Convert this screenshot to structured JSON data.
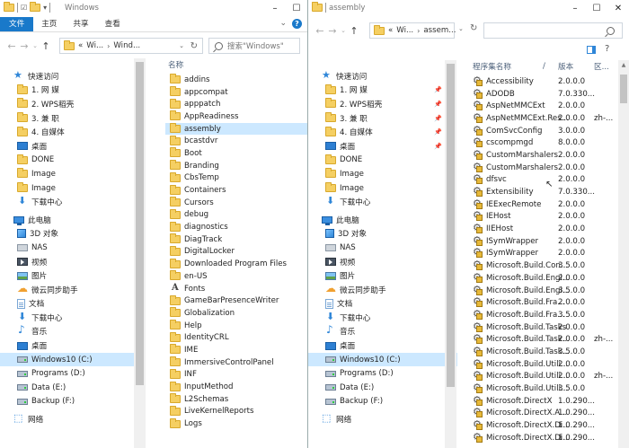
{
  "left": {
    "title": "Windows",
    "tabs": [
      "文件",
      "主页",
      "共享",
      "查看"
    ],
    "address": [
      "Wi...",
      "Wind..."
    ],
    "address_prefix": "«",
    "search_placeholder": "搜索\"Windows\"",
    "column_name": "名称",
    "nav": [
      {
        "label": "快速访问",
        "icon": "star-icon",
        "pinned": false
      },
      {
        "label": "1. 网    媒",
        "icon": "folder-icon",
        "pinned": true
      },
      {
        "label": "2. WPS稻壳",
        "icon": "folder-icon",
        "pinned": true
      },
      {
        "label": "3. 兼    职",
        "icon": "folder-icon",
        "pinned": true
      },
      {
        "label": "4. 自媒体",
        "icon": "folder-icon",
        "pinned": true
      },
      {
        "label": "桌面",
        "icon": "desktop-icon",
        "pinned": true
      },
      {
        "label": "DONE",
        "icon": "folder-icon",
        "pinned": false
      },
      {
        "label": "Image",
        "icon": "folder-icon",
        "pinned": false
      },
      {
        "label": "Image",
        "icon": "folder-icon",
        "pinned": false
      },
      {
        "label": "下载中心",
        "icon": "download-icon",
        "pinned": false
      },
      {
        "label": "此电脑",
        "icon": "pc-icon",
        "pinned": false,
        "gap": true
      },
      {
        "label": "3D 对象",
        "icon": "cube-icon",
        "pinned": false
      },
      {
        "label": "NAS",
        "icon": "nas-icon",
        "pinned": false
      },
      {
        "label": "视频",
        "icon": "video-icon",
        "pinned": false
      },
      {
        "label": "图片",
        "icon": "picture-icon",
        "pinned": false
      },
      {
        "label": "微云同步助手",
        "icon": "cloud-icon",
        "pinned": false
      },
      {
        "label": "文档",
        "icon": "document-icon",
        "pinned": false
      },
      {
        "label": "下载中心",
        "icon": "download-icon",
        "pinned": false
      },
      {
        "label": "音乐",
        "icon": "music-icon",
        "pinned": false
      },
      {
        "label": "桌面",
        "icon": "desktop-icon",
        "pinned": false
      },
      {
        "label": "Windows10 (C:)",
        "icon": "drive-icon",
        "pinned": false,
        "selected": true
      },
      {
        "label": "Programs (D:)",
        "icon": "drive-icon",
        "pinned": false
      },
      {
        "label": "Data (E:)",
        "icon": "drive-icon",
        "pinned": false
      },
      {
        "label": "Backup (F:)",
        "icon": "drive-icon",
        "pinned": false
      },
      {
        "label": "网络",
        "icon": "network-icon",
        "pinned": false,
        "gap": true
      }
    ],
    "files": [
      {
        "name": "addins",
        "icon": "folder-icon"
      },
      {
        "name": "appcompat",
        "icon": "folder-icon"
      },
      {
        "name": "apppatch",
        "icon": "folder-icon"
      },
      {
        "name": "AppReadiness",
        "icon": "folder-icon"
      },
      {
        "name": "assembly",
        "icon": "folder-icon",
        "selected": true
      },
      {
        "name": "bcastdvr",
        "icon": "folder-icon"
      },
      {
        "name": "Boot",
        "icon": "folder-icon"
      },
      {
        "name": "Branding",
        "icon": "folder-icon"
      },
      {
        "name": "CbsTemp",
        "icon": "folder-icon"
      },
      {
        "name": "Containers",
        "icon": "folder-icon"
      },
      {
        "name": "Cursors",
        "icon": "folder-icon"
      },
      {
        "name": "debug",
        "icon": "folder-icon"
      },
      {
        "name": "diagnostics",
        "icon": "folder-icon"
      },
      {
        "name": "DiagTrack",
        "icon": "folder-icon"
      },
      {
        "name": "DigitalLocker",
        "icon": "folder-icon"
      },
      {
        "name": "Downloaded Program Files",
        "icon": "folder-icon"
      },
      {
        "name": "en-US",
        "icon": "folder-icon"
      },
      {
        "name": "Fonts",
        "icon": "font-folder-icon"
      },
      {
        "name": "GameBarPresenceWriter",
        "icon": "folder-icon"
      },
      {
        "name": "Globalization",
        "icon": "folder-icon"
      },
      {
        "name": "Help",
        "icon": "folder-icon"
      },
      {
        "name": "IdentityCRL",
        "icon": "folder-icon"
      },
      {
        "name": "IME",
        "icon": "folder-icon"
      },
      {
        "name": "ImmersiveControlPanel",
        "icon": "folder-icon"
      },
      {
        "name": "INF",
        "icon": "folder-icon"
      },
      {
        "name": "InputMethod",
        "icon": "folder-icon"
      },
      {
        "name": "L2Schemas",
        "icon": "folder-icon"
      },
      {
        "name": "LiveKernelReports",
        "icon": "folder-icon"
      },
      {
        "name": "Logs",
        "icon": "folder-icon"
      }
    ]
  },
  "right": {
    "title": "assembly",
    "address": [
      "Wi...",
      "assem..."
    ],
    "address_prefix": "«",
    "columns": [
      "程序集名称",
      "/",
      "版本",
      "区..."
    ],
    "nav": [
      {
        "label": "快速访问",
        "icon": "star-icon",
        "pinned": false
      },
      {
        "label": "1. 网    媒",
        "icon": "folder-icon",
        "pinned": true
      },
      {
        "label": "2. WPS稻壳",
        "icon": "folder-icon",
        "pinned": true
      },
      {
        "label": "3. 兼    职",
        "icon": "folder-icon",
        "pinned": true
      },
      {
        "label": "4. 自媒体",
        "icon": "folder-icon",
        "pinned": true
      },
      {
        "label": "桌面",
        "icon": "desktop-icon",
        "pinned": true
      },
      {
        "label": "DONE",
        "icon": "folder-icon",
        "pinned": false
      },
      {
        "label": "Image",
        "icon": "folder-icon",
        "pinned": false
      },
      {
        "label": "Image",
        "icon": "folder-icon",
        "pinned": false
      },
      {
        "label": "下载中心",
        "icon": "download-icon",
        "pinned": false
      },
      {
        "label": "此电脑",
        "icon": "pc-icon",
        "pinned": false,
        "gap": true
      },
      {
        "label": "3D 对象",
        "icon": "cube-icon",
        "pinned": false
      },
      {
        "label": "NAS",
        "icon": "nas-icon",
        "pinned": false
      },
      {
        "label": "视频",
        "icon": "video-icon",
        "pinned": false
      },
      {
        "label": "图片",
        "icon": "picture-icon",
        "pinned": false
      },
      {
        "label": "微云同步助手",
        "icon": "cloud-icon",
        "pinned": false
      },
      {
        "label": "文档",
        "icon": "document-icon",
        "pinned": false
      },
      {
        "label": "下载中心",
        "icon": "download-icon",
        "pinned": false
      },
      {
        "label": "音乐",
        "icon": "music-icon",
        "pinned": false
      },
      {
        "label": "桌面",
        "icon": "desktop-icon",
        "pinned": false
      },
      {
        "label": "Windows10 (C:)",
        "icon": "drive-icon",
        "pinned": false,
        "selected": true
      },
      {
        "label": "Programs (D:)",
        "icon": "drive-icon",
        "pinned": false
      },
      {
        "label": "Data (E:)",
        "icon": "drive-icon",
        "pinned": false
      },
      {
        "label": "Backup (F:)",
        "icon": "drive-icon",
        "pinned": false
      },
      {
        "label": "网络",
        "icon": "network-icon",
        "pinned": false,
        "gap": true
      }
    ],
    "assemblies": [
      {
        "name": "Accessibility",
        "version": "2.0.0.0",
        "culture": ""
      },
      {
        "name": "ADODB",
        "version": "7.0.330...",
        "culture": ""
      },
      {
        "name": "AspNetMMCExt",
        "version": "2.0.0.0",
        "culture": ""
      },
      {
        "name": "AspNetMMCExt.Res...",
        "version": "2.0.0.0",
        "culture": "zh-..."
      },
      {
        "name": "ComSvcConfig",
        "version": "3.0.0.0",
        "culture": ""
      },
      {
        "name": "cscompmgd",
        "version": "8.0.0.0",
        "culture": ""
      },
      {
        "name": "CustomMarshalers",
        "version": "2.0.0.0",
        "culture": ""
      },
      {
        "name": "CustomMarshalers",
        "version": "2.0.0.0",
        "culture": ""
      },
      {
        "name": "dfsvc",
        "version": "2.0.0.0",
        "culture": ""
      },
      {
        "name": "Extensibility",
        "version": "7.0.330...",
        "culture": ""
      },
      {
        "name": "IEExecRemote",
        "version": "2.0.0.0",
        "culture": ""
      },
      {
        "name": "IEHost",
        "version": "2.0.0.0",
        "culture": ""
      },
      {
        "name": "IIEHost",
        "version": "2.0.0.0",
        "culture": ""
      },
      {
        "name": "ISymWrapper",
        "version": "2.0.0.0",
        "culture": ""
      },
      {
        "name": "ISymWrapper",
        "version": "2.0.0.0",
        "culture": ""
      },
      {
        "name": "Microsoft.Build.Con...",
        "version": "3.5.0.0",
        "culture": ""
      },
      {
        "name": "Microsoft.Build.Engi...",
        "version": "2.0.0.0",
        "culture": ""
      },
      {
        "name": "Microsoft.Build.Engi...",
        "version": "3.5.0.0",
        "culture": ""
      },
      {
        "name": "Microsoft.Build.Fra...",
        "version": "2.0.0.0",
        "culture": ""
      },
      {
        "name": "Microsoft.Build.Fra...",
        "version": "3.5.0.0",
        "culture": ""
      },
      {
        "name": "Microsoft.Build.Tasks",
        "version": "2.0.0.0",
        "culture": ""
      },
      {
        "name": "Microsoft.Build.Task...",
        "version": "2.0.0.0",
        "culture": "zh-..."
      },
      {
        "name": "Microsoft.Build.Task...",
        "version": "3.5.0.0",
        "culture": ""
      },
      {
        "name": "Microsoft.Build.Utili...",
        "version": "2.0.0.0",
        "culture": ""
      },
      {
        "name": "Microsoft.Build.Utili...",
        "version": "2.0.0.0",
        "culture": "zh-..."
      },
      {
        "name": "Microsoft.Build.Utili...",
        "version": "3.5.0.0",
        "culture": ""
      },
      {
        "name": "Microsoft.DirectX",
        "version": "1.0.290...",
        "culture": ""
      },
      {
        "name": "Microsoft.DirectX.A...",
        "version": "1.0.290...",
        "culture": ""
      },
      {
        "name": "Microsoft.DirectX.Di...",
        "version": "1.0.290...",
        "culture": ""
      },
      {
        "name": "Microsoft.DirectX.Di...",
        "version": "1.0.290...",
        "culture": ""
      }
    ]
  },
  "colors": {
    "accent": "#1979ca",
    "selection": "#cce8ff",
    "folder": "#f5cf62"
  }
}
